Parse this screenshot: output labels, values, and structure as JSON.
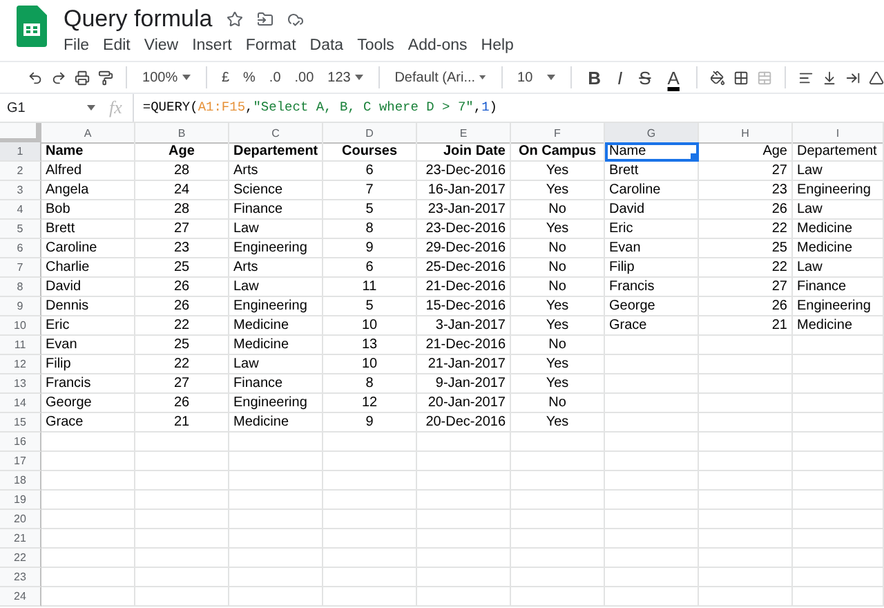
{
  "document": {
    "title": "Query formula",
    "menu": [
      "File",
      "Edit",
      "View",
      "Insert",
      "Format",
      "Data",
      "Tools",
      "Add-ons",
      "Help"
    ]
  },
  "toolbar": {
    "zoom": "100%",
    "currency": "£",
    "percent": "%",
    "decrease_decimals": ".0",
    "increase_decimals": ".00",
    "number_format": "123",
    "font": "Default (Ari...",
    "font_size": "10",
    "text_styles": [
      "B",
      "I",
      "S",
      "A"
    ]
  },
  "formula_bar": {
    "cell": "G1",
    "fx": "fx",
    "formula": [
      {
        "kind": "plain",
        "text": "=QUERY("
      },
      {
        "kind": "range",
        "text": "A1:F15"
      },
      {
        "kind": "plain",
        "text": ","
      },
      {
        "kind": "string",
        "text": "\"Select A, B, C where D > 7\""
      },
      {
        "kind": "plain",
        "text": ","
      },
      {
        "kind": "number",
        "text": "1"
      },
      {
        "kind": "plain",
        "text": ")"
      }
    ]
  },
  "sheet": {
    "columns": [
      {
        "label": "A",
        "selected": false
      },
      {
        "label": "B",
        "selected": false
      },
      {
        "label": "C",
        "selected": false
      },
      {
        "label": "D",
        "selected": false
      },
      {
        "label": "E",
        "selected": false
      },
      {
        "label": "F",
        "selected": false
      },
      {
        "label": "G",
        "selected": true
      },
      {
        "label": "H",
        "selected": false
      },
      {
        "label": "I",
        "selected": false
      }
    ],
    "rows": [
      {
        "number": "1",
        "selected": true,
        "cells": [
          "Name",
          "Age",
          "Departement",
          "Courses",
          "Join Date",
          "On Campus",
          "Name",
          "Age",
          "Departement"
        ]
      },
      {
        "number": "2",
        "selected": false,
        "cells": [
          "Alfred",
          "28",
          "Arts",
          "6",
          "23-Dec-2016",
          "Yes",
          "Brett",
          "27",
          "Law"
        ]
      },
      {
        "number": "3",
        "selected": false,
        "cells": [
          "Angela",
          "24",
          "Science",
          "7",
          "16-Jan-2017",
          "Yes",
          "Caroline",
          "23",
          "Engineering"
        ]
      },
      {
        "number": "4",
        "selected": false,
        "cells": [
          "Bob",
          "28",
          "Finance",
          "5",
          "23-Jan-2017",
          "No",
          "David",
          "26",
          "Law"
        ]
      },
      {
        "number": "5",
        "selected": false,
        "cells": [
          "Brett",
          "27",
          "Law",
          "8",
          "23-Dec-2016",
          "Yes",
          "Eric",
          "22",
          "Medicine"
        ]
      },
      {
        "number": "6",
        "selected": false,
        "cells": [
          "Caroline",
          "23",
          "Engineering",
          "9",
          "29-Dec-2016",
          "No",
          "Evan",
          "25",
          "Medicine"
        ]
      },
      {
        "number": "7",
        "selected": false,
        "cells": [
          "Charlie",
          "25",
          "Arts",
          "6",
          "25-Dec-2016",
          "No",
          "Filip",
          "22",
          "Law"
        ]
      },
      {
        "number": "8",
        "selected": false,
        "cells": [
          "David",
          "26",
          "Law",
          "11",
          "21-Dec-2016",
          "No",
          "Francis",
          "27",
          "Finance"
        ]
      },
      {
        "number": "9",
        "selected": false,
        "cells": [
          "Dennis",
          "26",
          "Engineering",
          "5",
          "15-Dec-2016",
          "Yes",
          "George",
          "26",
          "Engineering"
        ]
      },
      {
        "number": "10",
        "selected": false,
        "cells": [
          "Eric",
          "22",
          "Medicine",
          "10",
          "3-Jan-2017",
          "Yes",
          "Grace",
          "21",
          "Medicine"
        ]
      },
      {
        "number": "11",
        "selected": false,
        "cells": [
          "Evan",
          "25",
          "Medicine",
          "13",
          "21-Dec-2016",
          "No"
        ]
      },
      {
        "number": "12",
        "selected": false,
        "cells": [
          "Filip",
          "22",
          "Law",
          "10",
          "21-Jan-2017",
          "Yes"
        ]
      },
      {
        "number": "13",
        "selected": false,
        "cells": [
          "Francis",
          "27",
          "Finance",
          "8",
          "9-Jan-2017",
          "Yes"
        ]
      },
      {
        "number": "14",
        "selected": false,
        "cells": [
          "George",
          "26",
          "Engineering",
          "12",
          "20-Jan-2017",
          "No"
        ]
      },
      {
        "number": "15",
        "selected": false,
        "cells": [
          "Grace",
          "21",
          "Medicine",
          "9",
          "20-Dec-2016",
          "Yes"
        ]
      },
      {
        "number": "16",
        "selected": false
      },
      {
        "number": "17",
        "selected": false
      },
      {
        "number": "18",
        "selected": false
      },
      {
        "number": "19",
        "selected": false
      },
      {
        "number": "20",
        "selected": false
      },
      {
        "number": "21",
        "selected": false
      },
      {
        "number": "22",
        "selected": false
      },
      {
        "number": "23",
        "selected": false
      },
      {
        "number": "24",
        "selected": false
      }
    ]
  }
}
